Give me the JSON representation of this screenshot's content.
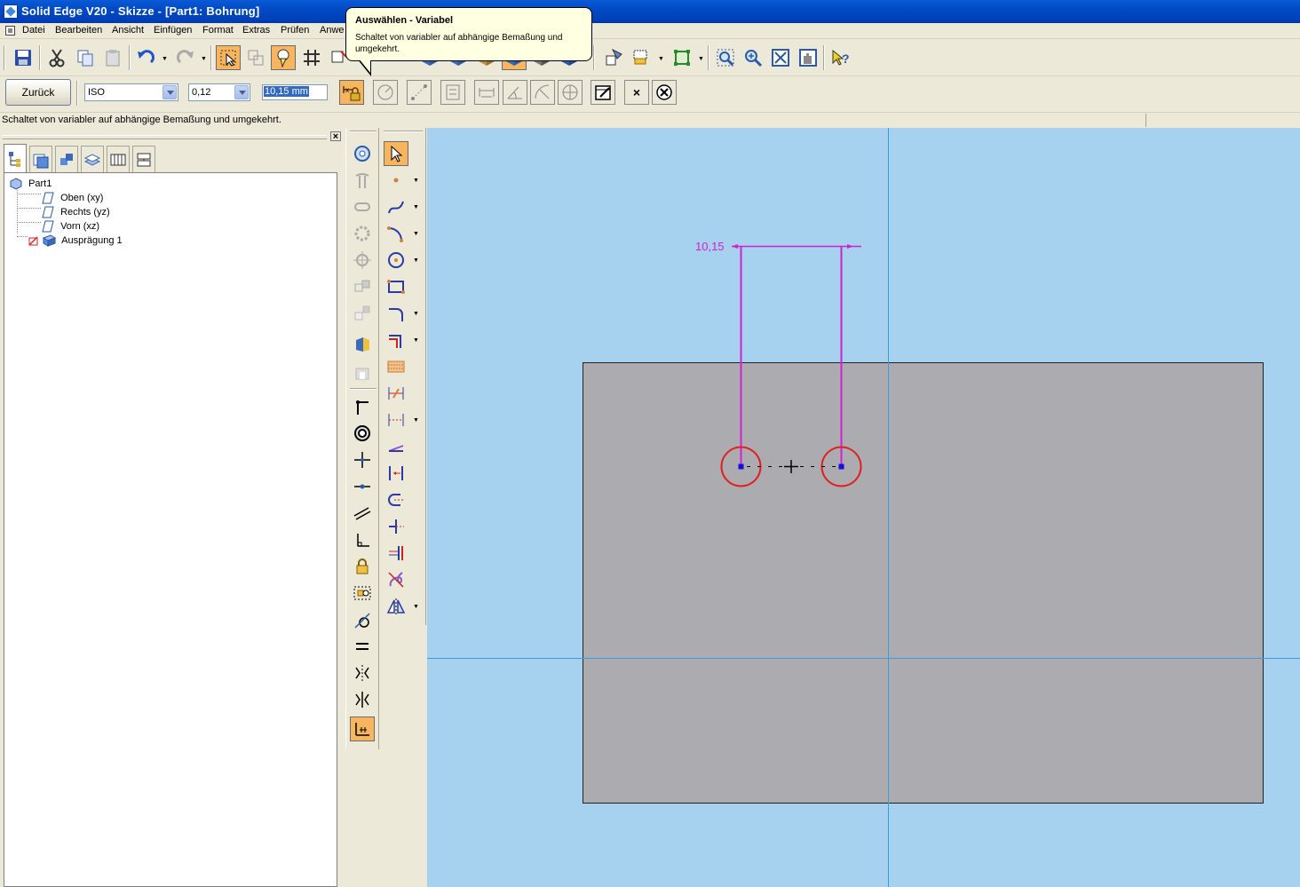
{
  "window": {
    "title": "Solid Edge V20 - Skizze - [Part1: Bohrung]"
  },
  "menu": {
    "items": [
      "Datei",
      "Bearbeiten",
      "Ansicht",
      "Einfügen",
      "Format",
      "Extras",
      "Prüfen",
      "Anwe"
    ]
  },
  "tooltip": {
    "title": "Auswählen - Variabel",
    "text": "Schaltet von variabler auf abhängige Bemaßung und umgekehrt."
  },
  "ribbon": {
    "back_label": "Zurück",
    "standard_value": "ISO",
    "tolerance_value": "0,12",
    "dimension_value": "10,15 mm",
    "close_x": "×"
  },
  "status": {
    "text": "Schaltet von variabler auf abhängige Bemaßung und umgekehrt."
  },
  "tree": {
    "root": "Part1",
    "items": [
      "Oben (xy)",
      "Rechts (yz)",
      "Vorn (xz)",
      "Ausprägung 1"
    ]
  },
  "panel": {
    "close": "×"
  },
  "sketch": {
    "dimension_label": "10,15"
  },
  "colors": {
    "canvas": "#a6d2f0",
    "plate": "#acacb0",
    "dimension": "#d020d0",
    "hole_circle": "#e02020",
    "active_button": "#f8b560"
  }
}
